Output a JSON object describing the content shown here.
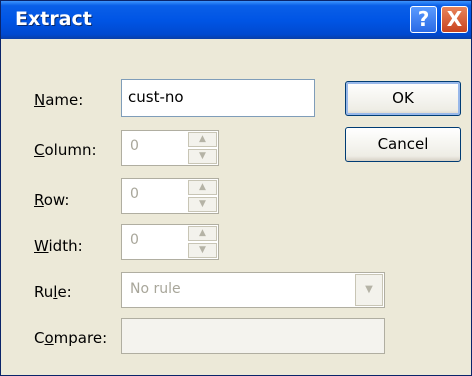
{
  "window": {
    "title": "Extract",
    "help_label": "?",
    "close_label": "X"
  },
  "form": {
    "name": {
      "label": "Name:",
      "mnemonic": "N",
      "rest": "ame:",
      "value": "cust-no"
    },
    "column": {
      "label": "Column:",
      "mnemonic": "C",
      "rest": "olumn:",
      "value": "0"
    },
    "row": {
      "label": "Row:",
      "mnemonic": "R",
      "rest": "ow:",
      "value": "0"
    },
    "width": {
      "label": "Width:",
      "mnemonic": "W",
      "rest": "idth:",
      "value": "0"
    },
    "rule": {
      "label": "Rule:",
      "pre": "Ru",
      "mnemonic": "l",
      "rest": "e:",
      "value": "No rule"
    },
    "compare": {
      "label": "Compare:",
      "pre": "C",
      "mnemonic": "o",
      "rest": "mpare:",
      "value": ""
    }
  },
  "buttons": {
    "ok": "OK",
    "cancel": "Cancel"
  },
  "icons": {
    "spin_up": "▲",
    "spin_down": "▼",
    "dropdown": "▼"
  }
}
